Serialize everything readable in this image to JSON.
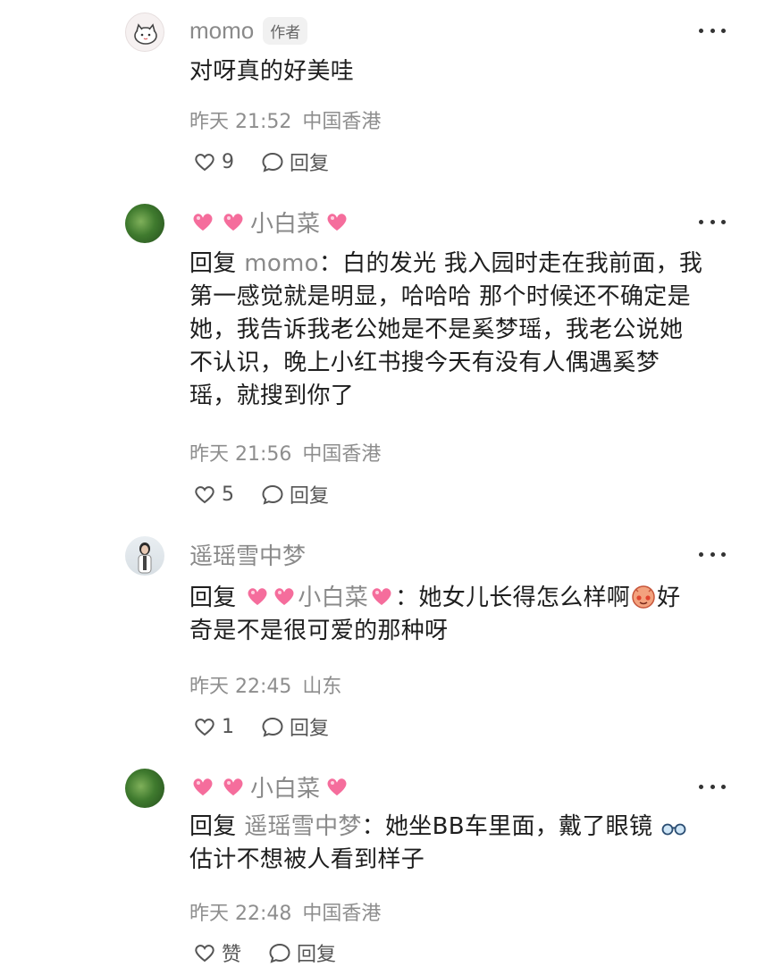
{
  "comments": [
    {
      "username": "momo",
      "badge": "作者",
      "text": "对呀真的好美哇",
      "time": "昨天 21:52",
      "location": "中国香港",
      "likes": "9",
      "reply_label": "回复"
    },
    {
      "username": "小白菜",
      "reply_prefix": "回复",
      "reply_target": "momo",
      "lines": [
        "：白的发光 我入园时走在我前面，我",
        "第一感觉就是明显，哈哈哈 那个时候还不确定是",
        "她，我告诉我老公她是不是奚梦瑶，我老公说她",
        "不认识，晚上小红书搜今天有没有人偶遇奚梦",
        "瑶，就搜到你了"
      ],
      "time": "昨天 21:56",
      "location": "中国香港",
      "likes": "5",
      "reply_label": "回复"
    },
    {
      "username": "遥瑶雪中梦",
      "reply_prefix": "回复",
      "reply_target": "小白菜",
      "line1_text": "：她女儿长得怎么样啊",
      "line1_tail": "好",
      "line2": "奇是不是很可爱的那种呀",
      "time": "昨天 22:45",
      "location": "山东",
      "likes": "1",
      "reply_label": "回复"
    },
    {
      "username": "小白菜",
      "reply_prefix": "回复",
      "reply_target": "遥瑶雪中梦",
      "line1_text": "：她坐BB车里面，戴了眼镜",
      "line2": "估计不想被人看到样子",
      "time": "昨天 22:48",
      "location": "中国香港",
      "likes": "赞",
      "reply_label": "回复"
    }
  ],
  "colors": {
    "meta": "#8e8e8e",
    "text": "#1e1e1e",
    "heart_pink": "#f06a9a"
  }
}
